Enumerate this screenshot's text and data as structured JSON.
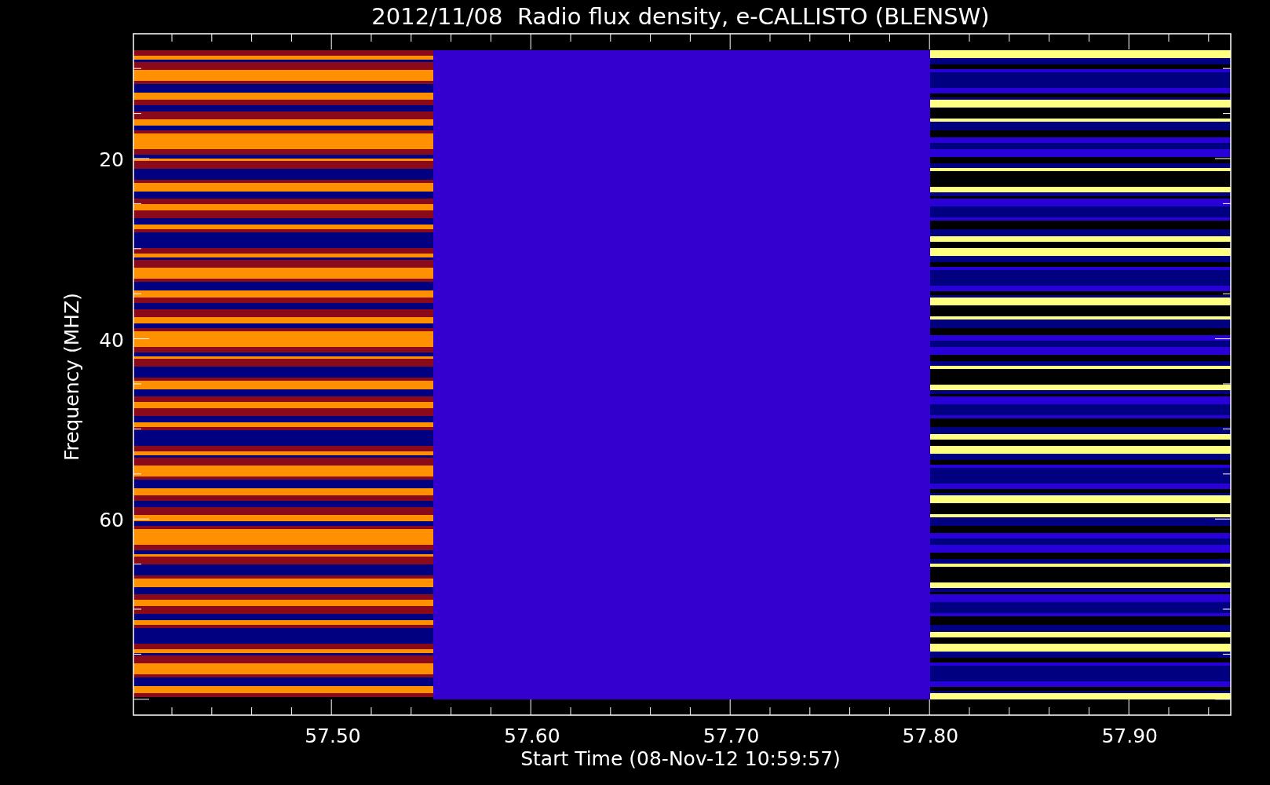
{
  "title": "2012/11/08  Radio flux density, e-CALLISTO (BLENSW)",
  "ylabel": "Frequency (MHZ)",
  "xlabel": "Start Time (08-Nov-12 10:59:57)",
  "yticks": [
    "20",
    "40",
    "60"
  ],
  "xticks": [
    "57.50",
    "57.60",
    "57.70",
    "57.80",
    "57.90"
  ]
}
